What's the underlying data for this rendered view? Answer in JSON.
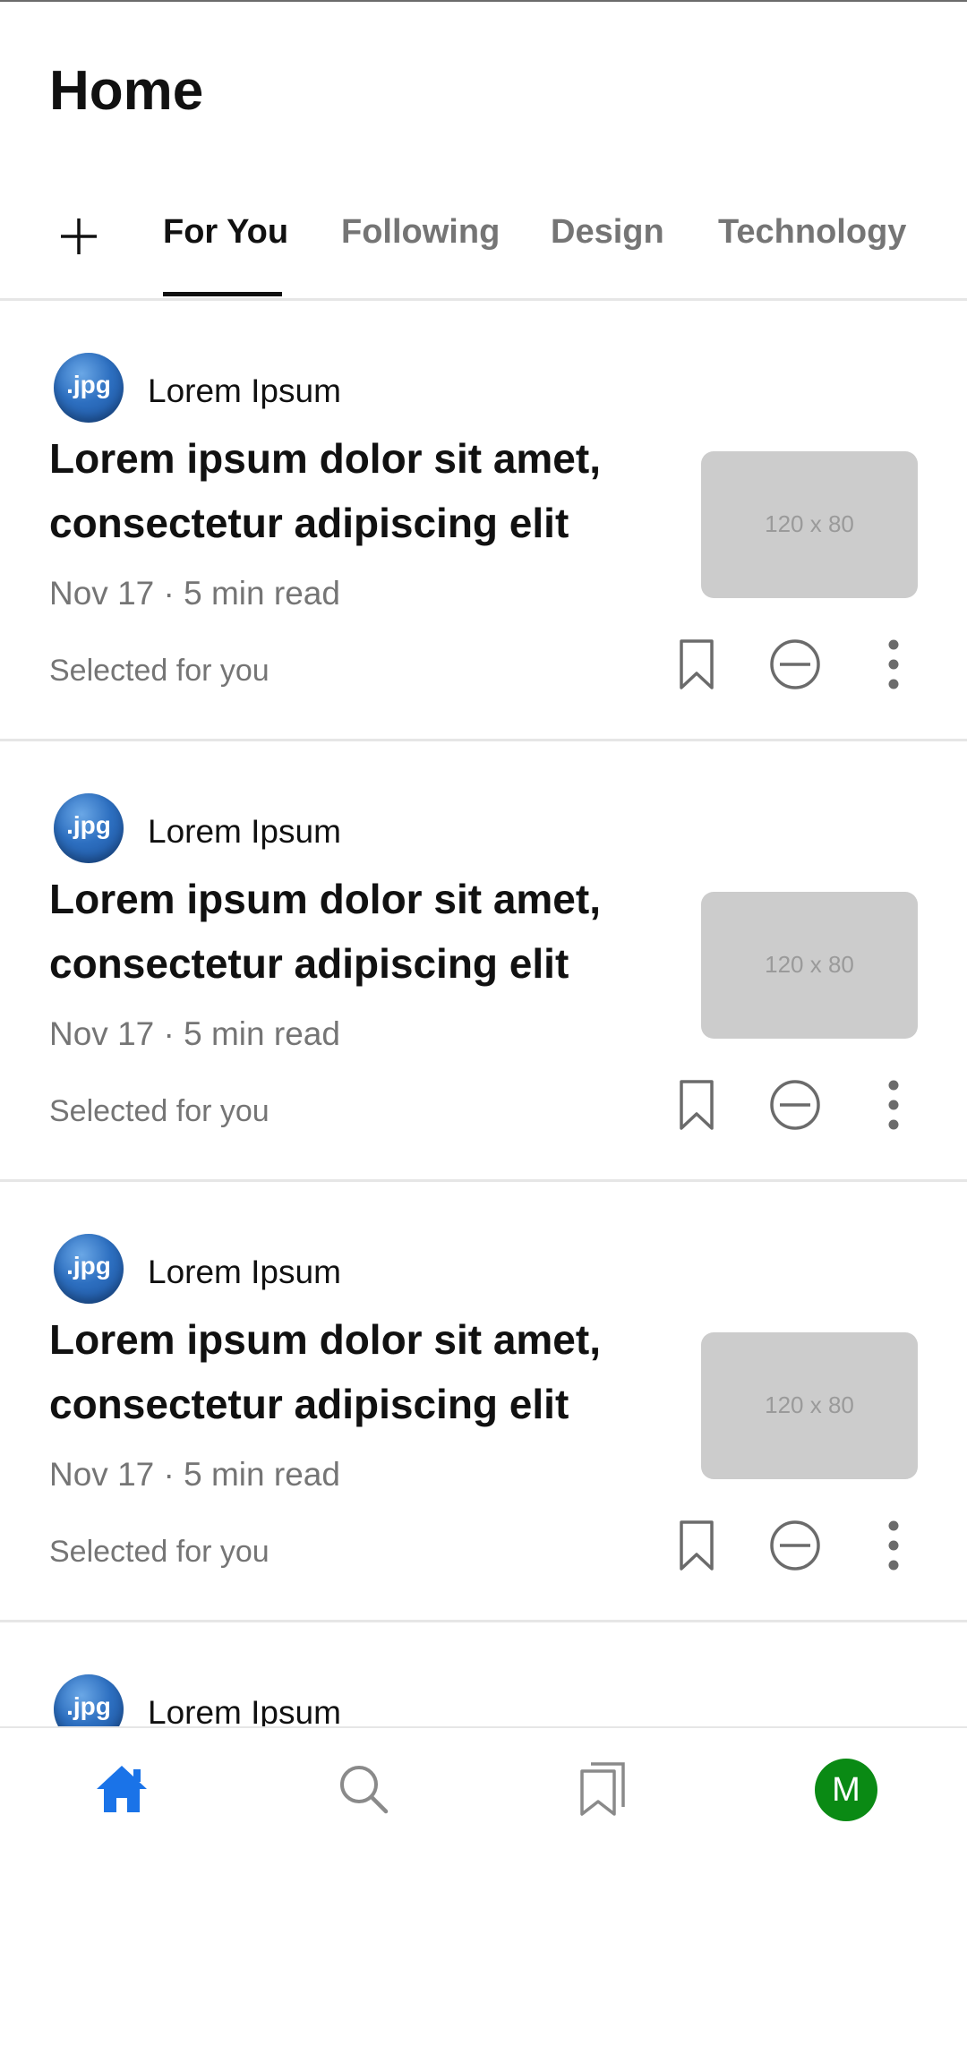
{
  "header": {
    "title": "Home"
  },
  "tabs": {
    "add_icon": "plus-icon",
    "items": [
      {
        "label": "For You",
        "active": true
      },
      {
        "label": "Following",
        "active": false
      },
      {
        "label": "Design",
        "active": false
      },
      {
        "label": "Technology",
        "active": false
      }
    ]
  },
  "feed": {
    "articles": [
      {
        "avatar_text": ".jpg",
        "author": "Lorem Ipsum",
        "title_line1": "Lorem ipsum dolor sit amet,",
        "title_line2": "consectetur adipiscing elit",
        "meta": "Nov 17 · 5 min read",
        "reason": "Selected for you",
        "thumbnail_label": "120 x 80"
      },
      {
        "avatar_text": ".jpg",
        "author": "Lorem Ipsum",
        "title_line1": "Lorem ipsum dolor sit amet,",
        "title_line2": "consectetur adipiscing elit",
        "meta": "Nov 17 · 5 min read",
        "reason": "Selected for you",
        "thumbnail_label": "120 x 80"
      },
      {
        "avatar_text": ".jpg",
        "author": "Lorem Ipsum",
        "title_line1": "Lorem ipsum dolor sit amet,",
        "title_line2": "consectetur adipiscing elit",
        "meta": "Nov 17 · 5 min read",
        "reason": "Selected for you",
        "thumbnail_label": "120 x 80"
      },
      {
        "avatar_text": ".jpg",
        "author": "Lorem Ipsum"
      }
    ]
  },
  "bottom_nav": {
    "items": [
      "home-icon",
      "search-icon",
      "bookmarks-icon"
    ],
    "profile_initial": "M",
    "colors": {
      "active": "#1a73e8",
      "inactive": "#8a8a8a",
      "profile": "#0a8a14"
    }
  }
}
